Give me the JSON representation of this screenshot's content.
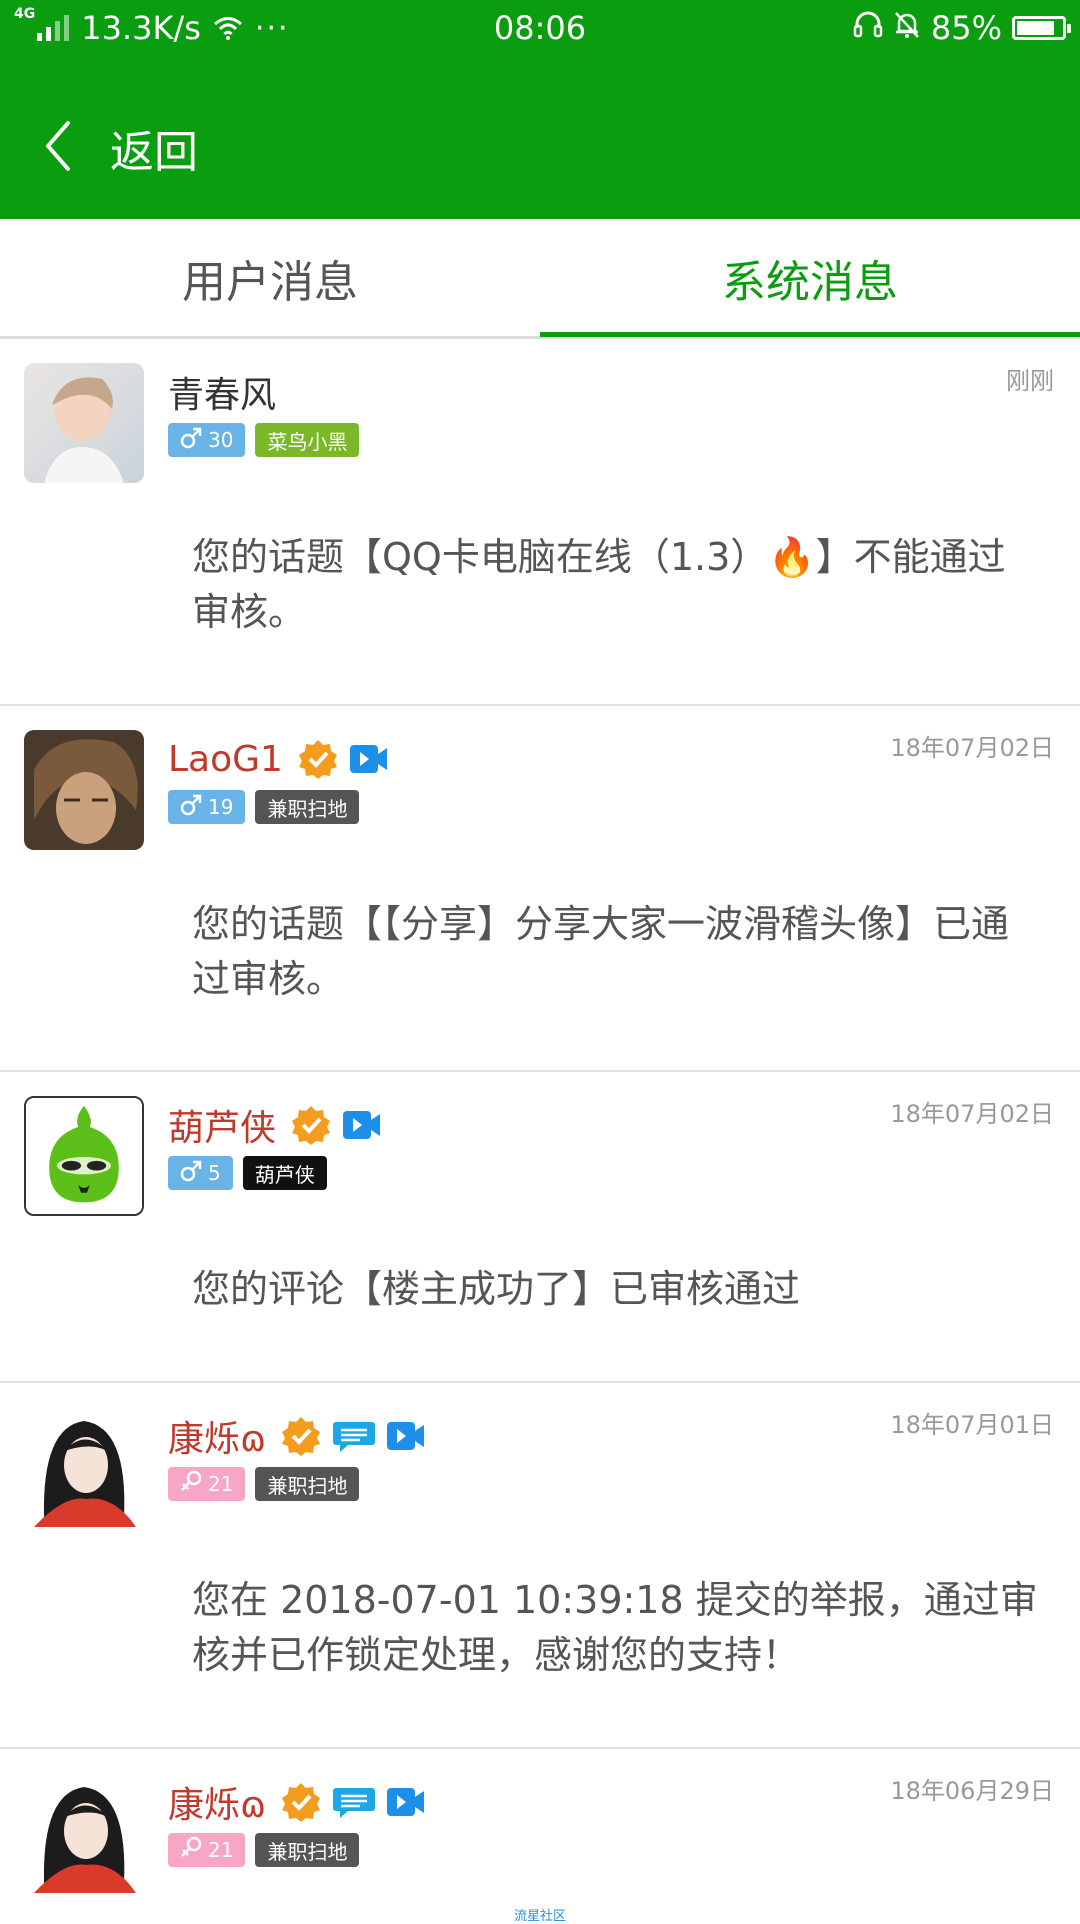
{
  "status_bar": {
    "network": "4G",
    "speed": "13.3K/s",
    "more": "···",
    "time": "08:06",
    "battery": "85%",
    "battery_level": 0.85
  },
  "header": {
    "back_label": "返回"
  },
  "tabs": [
    {
      "label": "用户消息",
      "active": false
    },
    {
      "label": "系统消息",
      "active": true
    }
  ],
  "colors": {
    "brand_green": "#0a9d10",
    "male_tag": "#69b3e7",
    "female_tag": "#f7a6c6",
    "name_red": "#c0392b"
  },
  "messages": [
    {
      "username": "青春风",
      "name_color": "#333333",
      "verified": false,
      "extra_icons": [],
      "age": "30",
      "gender": "male",
      "title_tag": "菜鸟小黑",
      "title_color": "#7ab829",
      "time": "刚刚",
      "content_before": "您的话题【QQ卡电脑在线（1.3）",
      "content_emoji": "🔥",
      "content_after": "】不能通过审核。"
    },
    {
      "username": "LaoG1",
      "name_color": "#c0392b",
      "verified": true,
      "extra_icons": [
        "video-icon"
      ],
      "age": "19",
      "gender": "male",
      "title_tag": "兼职扫地",
      "title_color": "#555555",
      "time": "18年07月02日",
      "content": "您的话题【【分享】分享大家一波滑稽头像】已通过审核。"
    },
    {
      "username": "葫芦侠",
      "name_color": "#c0392b",
      "verified": true,
      "extra_icons": [
        "video-icon"
      ],
      "age": "5",
      "gender": "male",
      "title_tag": "葫芦侠",
      "title_color": "#111111",
      "time": "18年07月02日",
      "content": "您的评论【楼主成功了】已审核通过"
    },
    {
      "username": "康烁ɷ",
      "name_color": "#c0392b",
      "verified": true,
      "extra_icons": [
        "chat-icon",
        "video-icon"
      ],
      "age": "21",
      "gender": "female",
      "title_tag": "兼职扫地",
      "title_color": "#555555",
      "time": "18年07月01日",
      "content": "您在 2018-07-01 10:39:18 提交的举报，通过审核并已作锁定处理，感谢您的支持！"
    },
    {
      "username": "康烁ɷ",
      "name_color": "#c0392b",
      "verified": true,
      "extra_icons": [
        "chat-icon",
        "video-icon"
      ],
      "age": "21",
      "gender": "female",
      "title_tag": "兼职扫地",
      "title_color": "#555555",
      "time": "18年06月29日",
      "content": ""
    }
  ],
  "watermark": "流星社区"
}
